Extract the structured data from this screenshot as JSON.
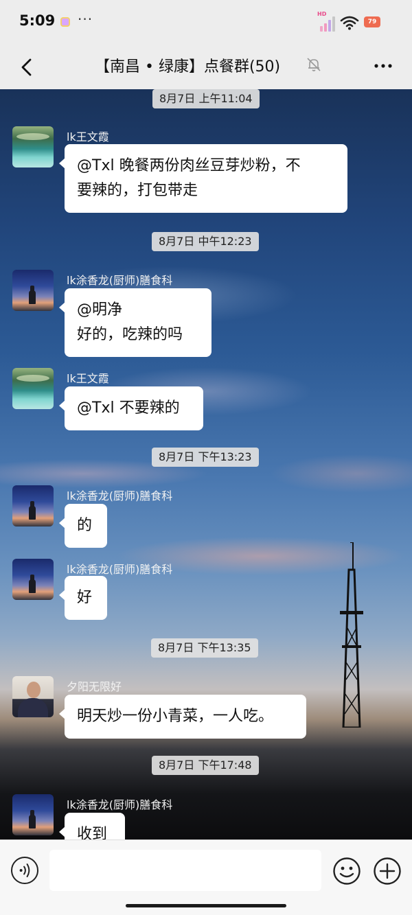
{
  "status_bar": {
    "time": "5:09",
    "more": "···",
    "hd": "HD",
    "battery": "79"
  },
  "nav": {
    "title": "【南昌 • 绿康】点餐群(50)"
  },
  "messages": [
    {
      "type": "time",
      "text": "8月7日 上午11:04"
    },
    {
      "type": "msg",
      "sender": "lk王文霞",
      "avatar": "landscape-avatar",
      "lines": [
        "@Txl  晚餐两份肉丝豆芽炒粉，不",
        "要辣的，打包带走"
      ]
    },
    {
      "type": "time",
      "text": "8月7日 中午12:23"
    },
    {
      "type": "msg",
      "sender": "lk涂香龙(厨师)膳食科",
      "avatar": "dusk-avatar",
      "lines": [
        "@明净",
        "好的，吃辣的吗"
      ]
    },
    {
      "type": "msg",
      "sender": "lk王文霞",
      "avatar": "landscape-avatar",
      "lines": [
        "@Txl  不要辣的"
      ]
    },
    {
      "type": "time",
      "text": "8月7日 下午13:23"
    },
    {
      "type": "msg",
      "sender": "lk涂香龙(厨师)膳食科",
      "avatar": "dusk-avatar",
      "lines": [
        "的"
      ]
    },
    {
      "type": "msg",
      "sender": "lk涂香龙(厨师)膳食科",
      "avatar": "dusk-avatar",
      "lines": [
        "好"
      ]
    },
    {
      "type": "time",
      "text": "8月7日 下午13:35"
    },
    {
      "type": "msg",
      "sender": "夕阳无限好",
      "avatar": "person-avatar",
      "lines": [
        "明天炒一份小青菜，一人吃。"
      ]
    },
    {
      "type": "time",
      "text": "8月7日 下午17:48"
    },
    {
      "type": "msg",
      "sender": "lk涂香龙(厨师)膳食科",
      "avatar": "dusk-avatar",
      "lines": [
        "收到"
      ]
    }
  ],
  "input": {
    "value": "",
    "placeholder": ""
  },
  "icons": {
    "back": "chevron-left-icon",
    "mute": "bell-off-icon",
    "more": "more-horizontal-icon",
    "voice": "voice-icon",
    "emoji": "smile-icon",
    "plus": "plus-circle-icon"
  },
  "colors": {
    "bubble": "#ffffff",
    "bar_bg": "#ededed",
    "sky_top": "#193259"
  }
}
